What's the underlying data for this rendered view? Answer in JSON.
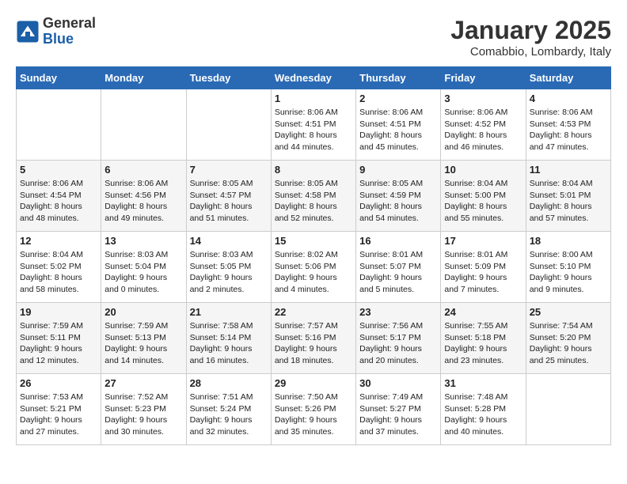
{
  "header": {
    "logo_general": "General",
    "logo_blue": "Blue",
    "month": "January 2025",
    "location": "Comabbio, Lombardy, Italy"
  },
  "days_of_week": [
    "Sunday",
    "Monday",
    "Tuesday",
    "Wednesday",
    "Thursday",
    "Friday",
    "Saturday"
  ],
  "weeks": [
    [
      {
        "day": "",
        "info": ""
      },
      {
        "day": "",
        "info": ""
      },
      {
        "day": "",
        "info": ""
      },
      {
        "day": "1",
        "info": "Sunrise: 8:06 AM\nSunset: 4:51 PM\nDaylight: 8 hours\nand 44 minutes."
      },
      {
        "day": "2",
        "info": "Sunrise: 8:06 AM\nSunset: 4:51 PM\nDaylight: 8 hours\nand 45 minutes."
      },
      {
        "day": "3",
        "info": "Sunrise: 8:06 AM\nSunset: 4:52 PM\nDaylight: 8 hours\nand 46 minutes."
      },
      {
        "day": "4",
        "info": "Sunrise: 8:06 AM\nSunset: 4:53 PM\nDaylight: 8 hours\nand 47 minutes."
      }
    ],
    [
      {
        "day": "5",
        "info": "Sunrise: 8:06 AM\nSunset: 4:54 PM\nDaylight: 8 hours\nand 48 minutes."
      },
      {
        "day": "6",
        "info": "Sunrise: 8:06 AM\nSunset: 4:56 PM\nDaylight: 8 hours\nand 49 minutes."
      },
      {
        "day": "7",
        "info": "Sunrise: 8:05 AM\nSunset: 4:57 PM\nDaylight: 8 hours\nand 51 minutes."
      },
      {
        "day": "8",
        "info": "Sunrise: 8:05 AM\nSunset: 4:58 PM\nDaylight: 8 hours\nand 52 minutes."
      },
      {
        "day": "9",
        "info": "Sunrise: 8:05 AM\nSunset: 4:59 PM\nDaylight: 8 hours\nand 54 minutes."
      },
      {
        "day": "10",
        "info": "Sunrise: 8:04 AM\nSunset: 5:00 PM\nDaylight: 8 hours\nand 55 minutes."
      },
      {
        "day": "11",
        "info": "Sunrise: 8:04 AM\nSunset: 5:01 PM\nDaylight: 8 hours\nand 57 minutes."
      }
    ],
    [
      {
        "day": "12",
        "info": "Sunrise: 8:04 AM\nSunset: 5:02 PM\nDaylight: 8 hours\nand 58 minutes."
      },
      {
        "day": "13",
        "info": "Sunrise: 8:03 AM\nSunset: 5:04 PM\nDaylight: 9 hours\nand 0 minutes."
      },
      {
        "day": "14",
        "info": "Sunrise: 8:03 AM\nSunset: 5:05 PM\nDaylight: 9 hours\nand 2 minutes."
      },
      {
        "day": "15",
        "info": "Sunrise: 8:02 AM\nSunset: 5:06 PM\nDaylight: 9 hours\nand 4 minutes."
      },
      {
        "day": "16",
        "info": "Sunrise: 8:01 AM\nSunset: 5:07 PM\nDaylight: 9 hours\nand 5 minutes."
      },
      {
        "day": "17",
        "info": "Sunrise: 8:01 AM\nSunset: 5:09 PM\nDaylight: 9 hours\nand 7 minutes."
      },
      {
        "day": "18",
        "info": "Sunrise: 8:00 AM\nSunset: 5:10 PM\nDaylight: 9 hours\nand 9 minutes."
      }
    ],
    [
      {
        "day": "19",
        "info": "Sunrise: 7:59 AM\nSunset: 5:11 PM\nDaylight: 9 hours\nand 12 minutes."
      },
      {
        "day": "20",
        "info": "Sunrise: 7:59 AM\nSunset: 5:13 PM\nDaylight: 9 hours\nand 14 minutes."
      },
      {
        "day": "21",
        "info": "Sunrise: 7:58 AM\nSunset: 5:14 PM\nDaylight: 9 hours\nand 16 minutes."
      },
      {
        "day": "22",
        "info": "Sunrise: 7:57 AM\nSunset: 5:16 PM\nDaylight: 9 hours\nand 18 minutes."
      },
      {
        "day": "23",
        "info": "Sunrise: 7:56 AM\nSunset: 5:17 PM\nDaylight: 9 hours\nand 20 minutes."
      },
      {
        "day": "24",
        "info": "Sunrise: 7:55 AM\nSunset: 5:18 PM\nDaylight: 9 hours\nand 23 minutes."
      },
      {
        "day": "25",
        "info": "Sunrise: 7:54 AM\nSunset: 5:20 PM\nDaylight: 9 hours\nand 25 minutes."
      }
    ],
    [
      {
        "day": "26",
        "info": "Sunrise: 7:53 AM\nSunset: 5:21 PM\nDaylight: 9 hours\nand 27 minutes."
      },
      {
        "day": "27",
        "info": "Sunrise: 7:52 AM\nSunset: 5:23 PM\nDaylight: 9 hours\nand 30 minutes."
      },
      {
        "day": "28",
        "info": "Sunrise: 7:51 AM\nSunset: 5:24 PM\nDaylight: 9 hours\nand 32 minutes."
      },
      {
        "day": "29",
        "info": "Sunrise: 7:50 AM\nSunset: 5:26 PM\nDaylight: 9 hours\nand 35 minutes."
      },
      {
        "day": "30",
        "info": "Sunrise: 7:49 AM\nSunset: 5:27 PM\nDaylight: 9 hours\nand 37 minutes."
      },
      {
        "day": "31",
        "info": "Sunrise: 7:48 AM\nSunset: 5:28 PM\nDaylight: 9 hours\nand 40 minutes."
      },
      {
        "day": "",
        "info": ""
      }
    ]
  ]
}
